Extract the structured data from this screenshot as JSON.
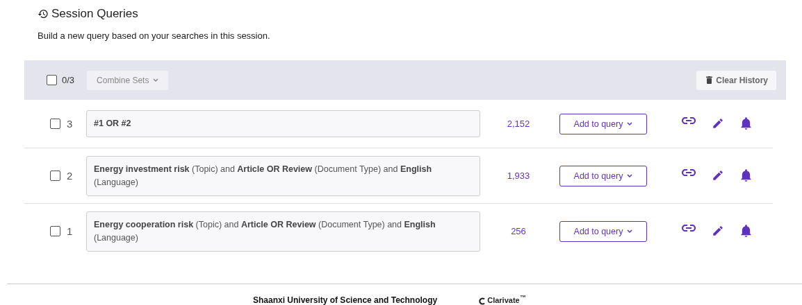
{
  "header": {
    "title": "Session Queries",
    "subtitle": "Build a new query based on your searches in this session."
  },
  "toolbar": {
    "select_all": {
      "checked": false,
      "label": "0/3"
    },
    "combine": {
      "label": "Combine Sets",
      "disabled": true
    },
    "clear": {
      "label": "Clear History"
    }
  },
  "rows": [
    {
      "checked": false,
      "number": "3",
      "query": "**#1 OR #2**",
      "count": "2,152",
      "action": "Add to query"
    },
    {
      "checked": false,
      "number": "2",
      "query": "**Energy investment risk** (Topic) and **Article OR Review** (Document Type) and **English** (Language)",
      "count": "1,933",
      "action": "Add to query"
    },
    {
      "checked": false,
      "number": "1",
      "query": "**Energy cooperation risk** (Topic) and **Article OR Review** (Document Type) and **English** (Language)",
      "count": "256",
      "action": "Add to query"
    }
  ],
  "footer": {
    "institution": "Shaanxi University of Science and Technology",
    "brand": "Clarivate$^{™}$"
  }
}
